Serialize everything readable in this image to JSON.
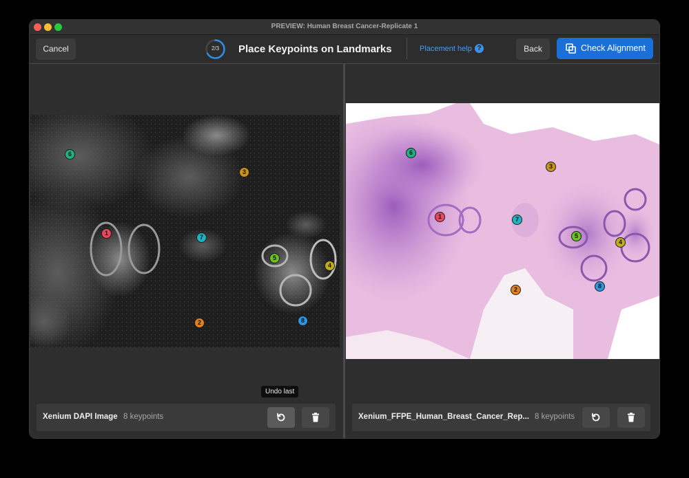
{
  "window": {
    "title": "PREVIEW: Human Breast Cancer-Replicate 1"
  },
  "toolbar": {
    "cancel_label": "Cancel",
    "step_progress": "2/3",
    "step_fraction": 0.6667,
    "heading": "Place Keypoints on Landmarks",
    "help_label": "Placement help",
    "help_icon": "?",
    "back_label": "Back",
    "check_label": "Check Alignment"
  },
  "left_panel": {
    "name": "Xenium DAPI Image",
    "count": "8 keypoints",
    "tooltip": "Undo last",
    "keypoints": [
      "1",
      "2",
      "3",
      "4",
      "5",
      "6",
      "7",
      "8"
    ]
  },
  "right_panel": {
    "name": "Xenium_FFPE_Human_Breast_Cancer_Rep...",
    "count": "8 keypoints",
    "keypoints": [
      "1",
      "2",
      "3",
      "4",
      "5",
      "6",
      "7",
      "8"
    ]
  },
  "colors": {
    "kp1": "#e8475e",
    "kp2": "#e0801e",
    "kp3": "#c9921c",
    "kp4": "#bfae1a",
    "kp5": "#6cc21f",
    "kp6": "#1fb283",
    "kp7": "#1fb3c1",
    "kp8": "#2a97e0",
    "accent": "#1a6fd8"
  }
}
